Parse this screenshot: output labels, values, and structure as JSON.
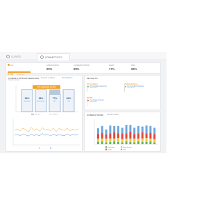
{
  "tabs": [
    {
      "label": "CLIENTS"
    },
    {
      "label": "CONNECTIVITY"
    }
  ],
  "kpi": {
    "first": {
      "label": "ALL",
      "value": "77%",
      "sub": "AVERAGE"
    },
    "items": [
      {
        "label": "ASSOCIATION",
        "value": "99%"
      },
      {
        "label": "AUTHENTICATION",
        "value": "98%"
      },
      {
        "label": "DHCP",
        "value": "77%"
      },
      {
        "label": "DNS",
        "value": "99%"
      }
    ]
  },
  "experience": {
    "title": "CONNECTION EXPERIENCE",
    "subtitle": "Overall success",
    "control1": "Success vs Failure",
    "control2": "All Locations ▾",
    "banner": "77% AVERAGE IN APR",
    "pct_labels": [
      "99%",
      "98%",
      "77%",
      "99%"
    ],
    "bar_sublabels": [
      "Association",
      "Authentication",
      "DHCP",
      "DNS"
    ],
    "legend": [
      "Success",
      "Failures"
    ]
  },
  "insights": {
    "title": "INSIGHTS",
    "cards": [
      {
        "head": "Association",
        "row1": "No Anomalies Detected",
        "row1_color": "#5cb85c",
        "link": "Learn more"
      },
      {
        "head": "Authentication",
        "row1": "No Anomalies Detected",
        "row1_color": "#5cb85c",
        "link": "Learn more"
      },
      {
        "head": "DHCP",
        "row1": "1 anomaly detected",
        "row1_color": "#e0483e",
        "link": "Learn more"
      }
    ]
  },
  "connections": {
    "title": "CONNECTIONS",
    "subtitle": "Last 30 minutes",
    "legend": [
      "Association",
      "Authentication",
      "DHCP",
      "DNS"
    ]
  },
  "colors": {
    "accent": "#f0a32a",
    "blue": "#4a90d9",
    "green": "#5cb85c",
    "red": "#e0483e",
    "yellow": "#f2c744"
  },
  "chart_data": [
    {
      "type": "bar",
      "categories": [
        "Association",
        "Authentication",
        "DHCP",
        "DNS"
      ],
      "series": [
        {
          "name": "Success",
          "values": [
            99,
            98,
            77,
            99
          ]
        },
        {
          "name": "Failures",
          "values": [
            1,
            2,
            23,
            1
          ]
        }
      ],
      "ylim": [
        0,
        100
      ]
    },
    {
      "type": "line",
      "series": [
        {
          "values": [
            48,
            52,
            45,
            55,
            50,
            42,
            58,
            47,
            53,
            44,
            57,
            49,
            51,
            46,
            56,
            43,
            54,
            50,
            47,
            55,
            45,
            52,
            48,
            53
          ]
        },
        {
          "values": [
            30,
            33,
            28,
            35,
            31,
            27,
            34,
            29,
            32,
            28,
            36,
            30,
            33,
            27,
            34,
            29,
            31,
            30,
            28,
            35,
            29,
            32,
            30,
            33
          ]
        }
      ],
      "ylim": [
        0,
        80
      ]
    },
    {
      "type": "bar",
      "categories": [
        "1",
        "2",
        "3",
        "4",
        "5",
        "6",
        "7",
        "8",
        "9",
        "10",
        "11",
        "12",
        "13",
        "14",
        "15"
      ],
      "series": [
        {
          "name": "DNS",
          "values": [
            10,
            12,
            9,
            14,
            11,
            13,
            10,
            15,
            12,
            11,
            13,
            10,
            14,
            12,
            11
          ]
        },
        {
          "name": "DHCP",
          "values": [
            8,
            10,
            7,
            9,
            11,
            8,
            10,
            9,
            12,
            8,
            9,
            11,
            8,
            10,
            9
          ]
        },
        {
          "name": "Authentication",
          "values": [
            6,
            5,
            7,
            6,
            5,
            7,
            6,
            5,
            6,
            7,
            5,
            6,
            7,
            5,
            6
          ]
        },
        {
          "name": "Association",
          "values": [
            4,
            5,
            3,
            4,
            5,
            4,
            3,
            5,
            4,
            3,
            5,
            4,
            4,
            5,
            3
          ]
        }
      ]
    }
  ]
}
